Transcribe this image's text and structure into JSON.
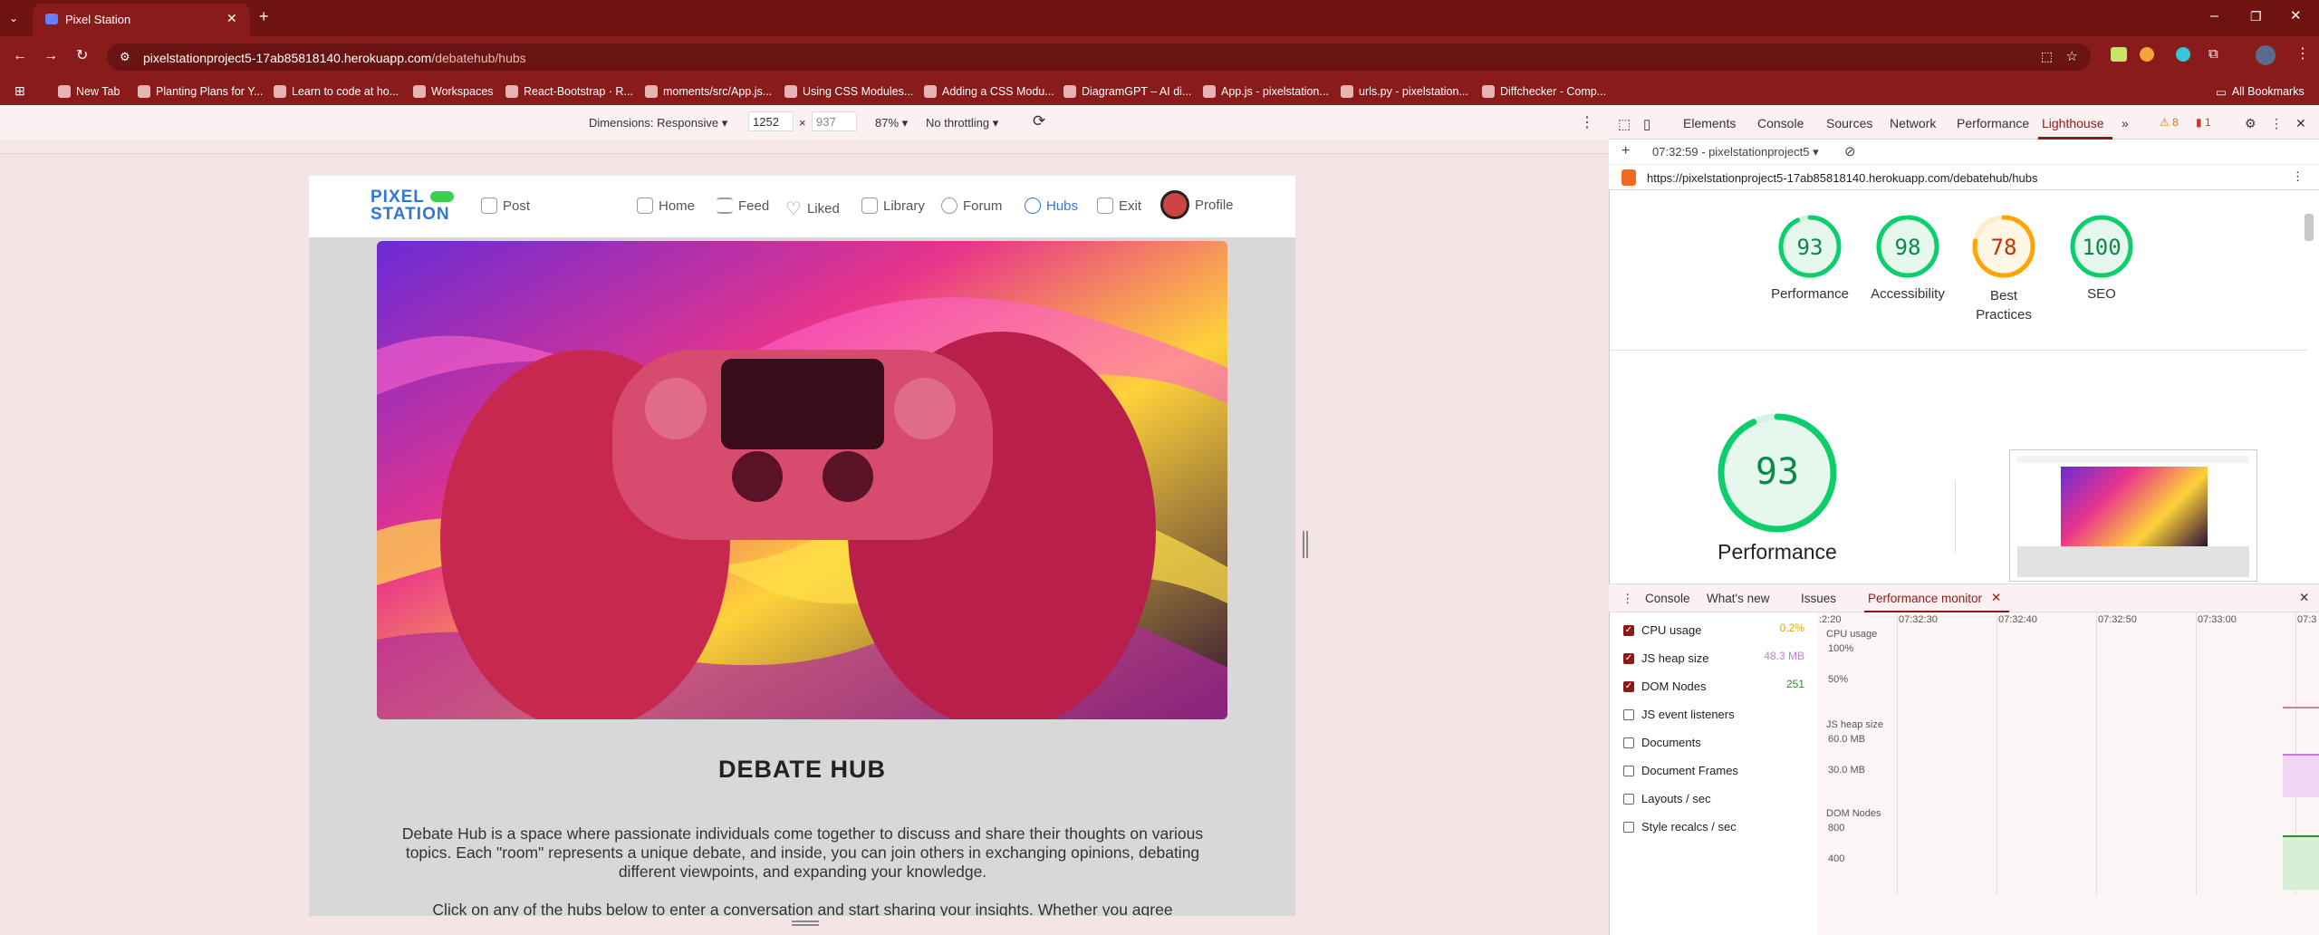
{
  "browser": {
    "tab_title": "Pixel Station",
    "url_host": "pixelstationproject5-17ab85818140.herokuapp.com",
    "url_path": "/debatehub/hubs",
    "bookmarks": [
      "New Tab",
      "Planting Plans for Y...",
      "Learn to code at ho...",
      "Workspaces",
      "React-Bootstrap · R...",
      "moments/src/App.js...",
      "Using CSS Modules...",
      "Adding a CSS Modu...",
      "DiagramGPT – AI di...",
      "App.js - pixelstation...",
      "urls.py - pixelstation...",
      "Diffchecker - Comp..."
    ],
    "all_bookmarks": "All Bookmarks"
  },
  "device_toolbar": {
    "dimensions_label": "Dimensions: Responsive",
    "width": "1252",
    "times": "×",
    "height": "937",
    "zoom": "87%",
    "throttling": "No throttling"
  },
  "site": {
    "logo_line1": "PIXEL",
    "logo_line2": "STATION",
    "nav": [
      "Post",
      "Home",
      "Feed",
      "Liked",
      "Library",
      "Forum",
      "Hubs",
      "Exit",
      "Profile"
    ],
    "title": "DEBATE HUB",
    "description": "Debate Hub is a space where passionate individuals come together to discuss and share their thoughts on various topics. Each \"room\" represents a unique debate, and inside, you can join others in exchanging opinions, debating different viewpoints, and expanding your knowledge.",
    "description2": "Click on any of the hubs below to enter a conversation and start sharing your insights. Whether you agree"
  },
  "devtools": {
    "tabs": [
      "Elements",
      "Console",
      "Sources",
      "Network",
      "Performance",
      "Lighthouse"
    ],
    "active_tab": "Lighthouse",
    "warnings": "8",
    "errors": "1",
    "report_time": "07:32:59 - pixelstationproject5",
    "report_url": "https://pixelstationproject5-17ab85818140.herokuapp.com/debatehub/hubs",
    "scores": [
      {
        "label": "Performance",
        "value": 93,
        "color": "#0cce6b"
      },
      {
        "label": "Accessibility",
        "value": 98,
        "color": "#0cce6b"
      },
      {
        "label": "Best Practices",
        "value": 78,
        "color": "#ffa400"
      },
      {
        "label": "SEO",
        "value": 100,
        "color": "#0cce6b"
      }
    ],
    "big_score": {
      "label": "Performance",
      "value": 93
    },
    "drawer_tabs": [
      "Console",
      "What's new",
      "Issues",
      "Performance monitor"
    ],
    "active_drawer_tab": "Performance monitor",
    "monitor": [
      {
        "label": "CPU usage",
        "checked": true,
        "value": "0.2%",
        "color": "#e0a800"
      },
      {
        "label": "JS heap size",
        "checked": true,
        "value": "48.3 MB",
        "color": "#c77dd8"
      },
      {
        "label": "DOM Nodes",
        "checked": true,
        "value": "251",
        "color": "#2e8b2e"
      },
      {
        "label": "JS event listeners",
        "checked": false,
        "value": "",
        "color": "#333"
      },
      {
        "label": "Documents",
        "checked": false,
        "value": "",
        "color": "#333"
      },
      {
        "label": "Document Frames",
        "checked": false,
        "value": "",
        "color": "#333"
      },
      {
        "label": "Layouts / sec",
        "checked": false,
        "value": "",
        "color": "#333"
      },
      {
        "label": "Style recalcs / sec",
        "checked": false,
        "value": "",
        "color": "#333"
      }
    ],
    "graph": {
      "times": [
        ":2:20",
        "07:32:30",
        "07:32:40",
        "07:32:50",
        "07:33:00",
        "07:3"
      ],
      "cpu_label": "CPU usage",
      "cpu_ticks": [
        "100%",
        "50%"
      ],
      "heap_label": "JS heap size",
      "heap_ticks": [
        "60.0 MB",
        "30.0 MB"
      ],
      "dom_label": "DOM Nodes",
      "dom_ticks": [
        "800",
        "400"
      ]
    }
  }
}
